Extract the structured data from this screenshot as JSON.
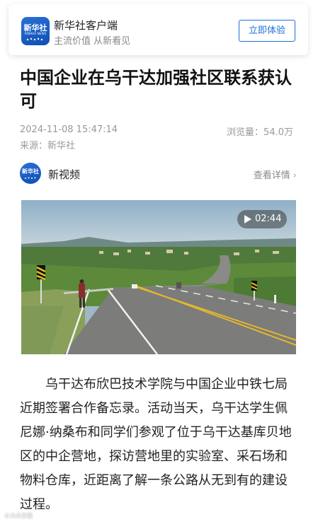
{
  "app_banner": {
    "logo_text": "新华社",
    "logo_subtext": "XINHUA NEWS",
    "name": "新华社客户端",
    "slogan": "主流价值 从新看见",
    "cta_label": "立即体验"
  },
  "article": {
    "title": "中国企业在乌干达加强社区联系获认可",
    "time": "2024-11-08 15:47:14",
    "source": "来源：新华社",
    "views": "浏览量：54.0万",
    "body": "乌干达布欣巴技术学院与中国企业中铁七局近期签署合作备忘录。活动当天，乌干达学生佩尼娜·纳桑布和同学们参观了位于乌干达基库贝地区的中企营地，探访营地里的实验室、采石场和物料仓库，近距离了解一条公路从无到有的建设过程。"
  },
  "channel": {
    "avatar_text": "新华社",
    "name": "新视频",
    "details_label": "查看详情",
    "details_icon": "chevron-right-icon"
  },
  "video": {
    "duration": "02:44",
    "play_icon": "play-icon"
  },
  "watermark": {
    "text": "©大众日报"
  },
  "colors": {
    "accent": "#1f6fd6",
    "muted_text": "#999999"
  }
}
